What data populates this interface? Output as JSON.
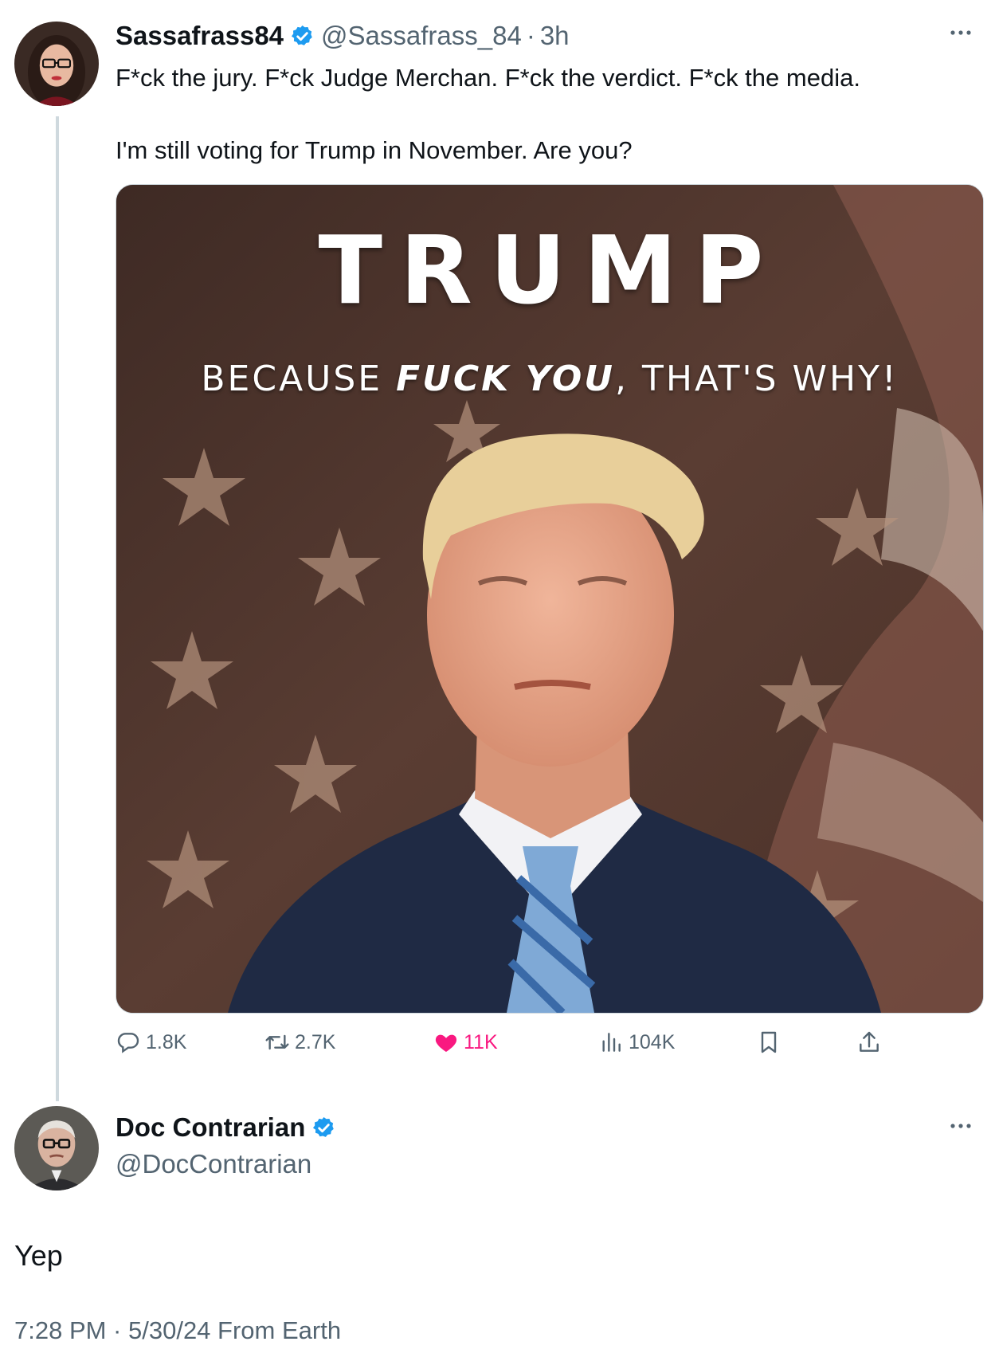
{
  "tweet": {
    "display_name": "Sassafrass84",
    "handle": "@Sassafrass_84",
    "separator": "·",
    "time": "3h",
    "text_line1": "F*ck the jury. F*ck Judge Merchan. F*ck the verdict. F*ck the media.",
    "text_line2": "I'm still voting for Trump in November. Are you?",
    "media": {
      "headline": "TRUMP",
      "sub_before": "BECAUSE ",
      "sub_emph": "FUCK YOU",
      "sub_after": ", THAT'S WHY!"
    },
    "actions": {
      "replies": "1.8K",
      "retweets": "2.7K",
      "likes": "11K",
      "views": "104K"
    }
  },
  "reply": {
    "display_name": "Doc Contrarian",
    "handle": "@DocContrarian",
    "text": "Yep",
    "timestamp": "7:28 PM · 5/30/24 From Earth"
  },
  "colors": {
    "verified": "#1d9bf0",
    "like": "#f91880",
    "muted": "#536471"
  }
}
